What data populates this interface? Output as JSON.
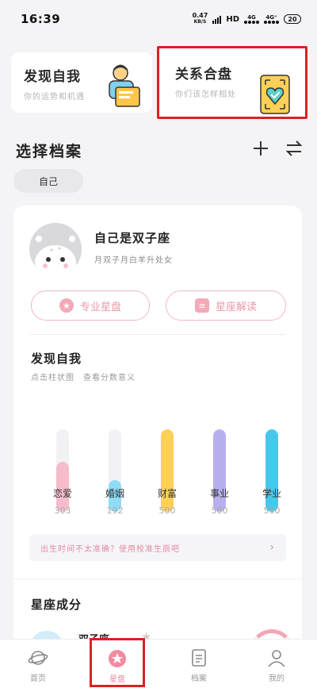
{
  "status_bar": {
    "time": "16:39",
    "speed_value": "0.47",
    "speed_unit": "KB/S",
    "hd": "HD",
    "net1": "4G",
    "net2": "4G⁺",
    "battery": "20"
  },
  "features": [
    {
      "title": "发现自我",
      "subtitle": "你的运势和机遇"
    },
    {
      "title": "关系合盘",
      "subtitle": "你们该怎样相处"
    }
  ],
  "section": {
    "title": "选择档案",
    "add_icon": "plus-icon",
    "switch_icon": "swap-icon"
  },
  "profile_chip": "自己",
  "profile": {
    "name": "自己是双子座",
    "desc": "月双子月白羊升处女",
    "btn_chart": "专业星盘",
    "btn_reading": "星座解读"
  },
  "discover": {
    "title": "发现自我",
    "desc": "点击柱状图　查看分数意义"
  },
  "chart_data": {
    "type": "bar",
    "categories": [
      "恋爱",
      "婚姻",
      "财富",
      "事业",
      "学业"
    ],
    "values": [
      303,
      192,
      500,
      500,
      500
    ],
    "value_labels": [
      "303",
      "192",
      "500",
      "500",
      "500"
    ],
    "ylim": [
      0,
      500
    ],
    "colors": [
      "#f7bccb",
      "#8fdcf6",
      "#ffd057",
      "#b8b0ee",
      "#48c7ec"
    ]
  },
  "notice": {
    "text": "出生时间不太准确？使用校准生辰吧",
    "arrow": "›"
  },
  "composition": {
    "title": "星座成分",
    "sign_name": "双子座",
    "element": "水"
  },
  "tabs": [
    {
      "label": "首页",
      "icon": "planet-icon"
    },
    {
      "label": "星盘",
      "icon": "star-badge-icon"
    },
    {
      "label": "档案",
      "icon": "document-icon"
    },
    {
      "label": "我的",
      "icon": "person-icon"
    }
  ]
}
